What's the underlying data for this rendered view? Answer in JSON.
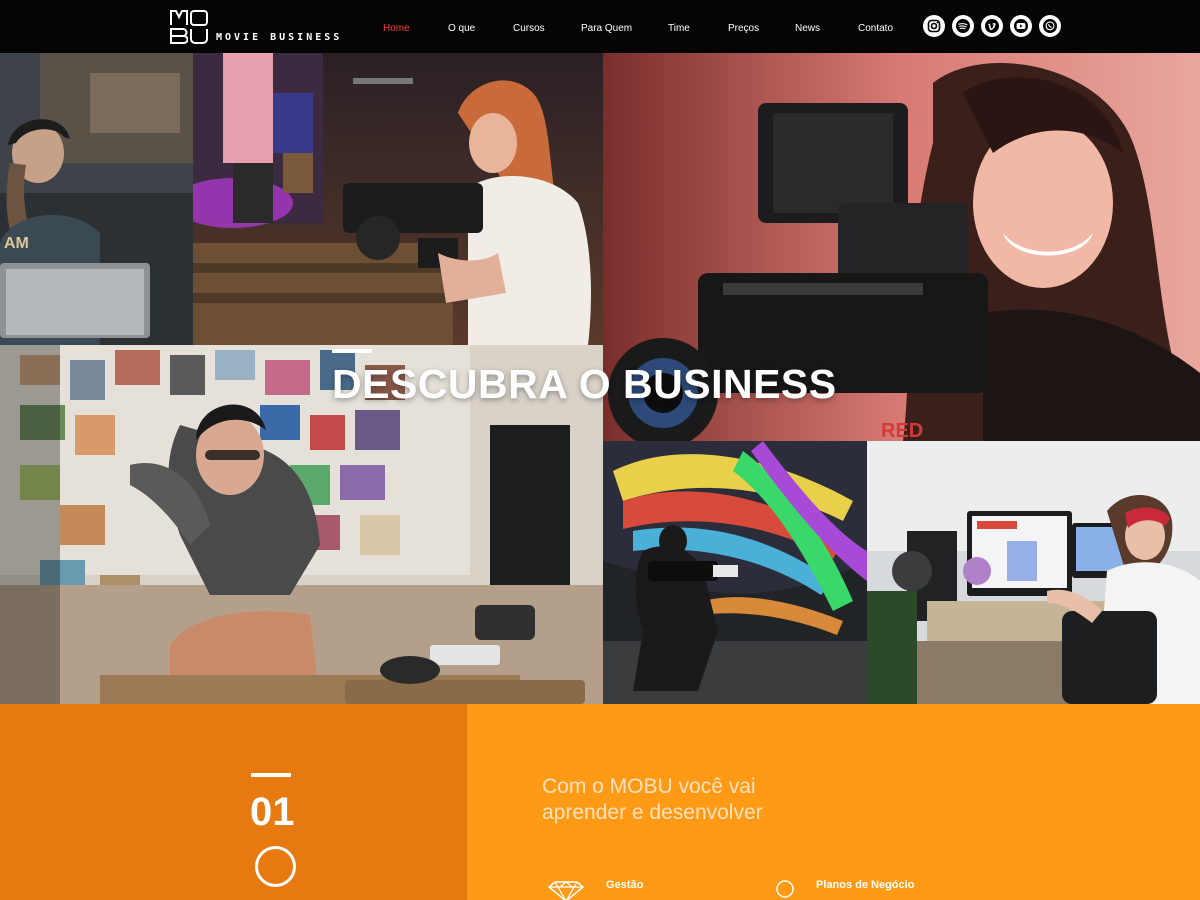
{
  "brand": {
    "logo_letters": [
      "M",
      "O",
      "B",
      "U"
    ],
    "name": "MOVIE BUSINESS"
  },
  "nav": {
    "items": [
      {
        "label": "Home",
        "active": true
      },
      {
        "label": "O que",
        "active": false
      },
      {
        "label": "Cursos",
        "active": false
      },
      {
        "label": "Para Quem",
        "active": false
      },
      {
        "label": "Time",
        "active": false
      },
      {
        "label": "Preços",
        "active": false
      },
      {
        "label": "News",
        "active": false
      },
      {
        "label": "Contato",
        "active": false
      }
    ]
  },
  "social": {
    "icons": [
      "instagram-icon",
      "spotify-icon",
      "vimeo-icon",
      "youtube-icon",
      "whatsapp-icon"
    ]
  },
  "hero": {
    "title": "DESCUBRA O BUSINESS",
    "slides_count": 4,
    "active_slide": 1
  },
  "section": {
    "number": "01",
    "tagline_line1": "Com o MOBU você vai",
    "tagline_line2": "aprender e desenvolver",
    "features": [
      {
        "label": "Gestão",
        "icon": "diamond-icon"
      },
      {
        "label": "Planos de Negócio",
        "icon": "circle-icon"
      }
    ]
  },
  "colors": {
    "header_bg": "#050505",
    "nav_active": "#ff3b3b",
    "orange_dark": "#e67a10",
    "orange_light": "#ff9a16",
    "tagline": "#ffe2bd"
  }
}
